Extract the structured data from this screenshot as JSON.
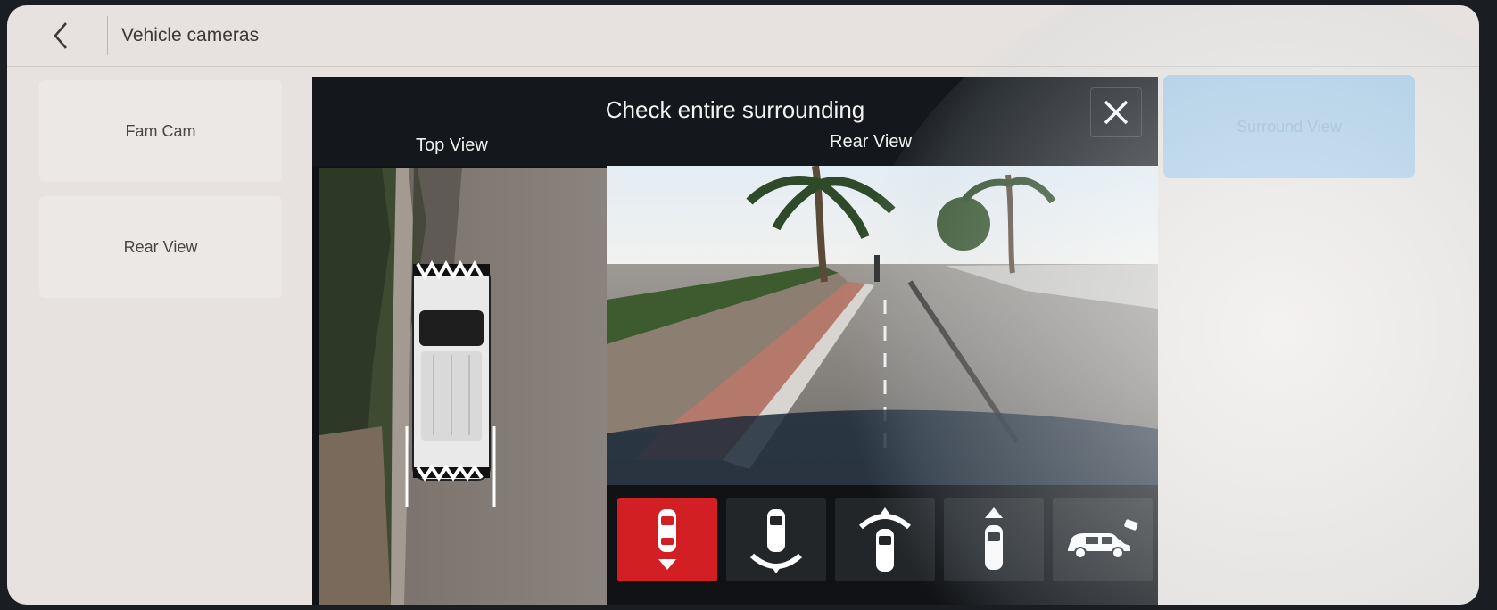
{
  "header": {
    "title": "Vehicle cameras"
  },
  "sidebar": {
    "items": [
      {
        "label": "Fam Cam"
      },
      {
        "label": "Rear View"
      }
    ]
  },
  "right_menu": {
    "surround_label": "Surround View"
  },
  "camera_panel": {
    "title": "Check entire surrounding",
    "top_view_label": "Top View",
    "rear_view_label": "Rear View",
    "modes": [
      {
        "icon": "car-rear-view-icon",
        "active": true
      },
      {
        "icon": "car-rear-wide-view-icon",
        "active": false
      },
      {
        "icon": "car-front-wide-view-icon",
        "active": false
      },
      {
        "icon": "car-front-view-icon",
        "active": false
      },
      {
        "icon": "car-side-camera-icon",
        "active": false
      }
    ]
  },
  "colors": {
    "active_mode": "#d11f24",
    "surround_button": "#a8cbe6"
  }
}
